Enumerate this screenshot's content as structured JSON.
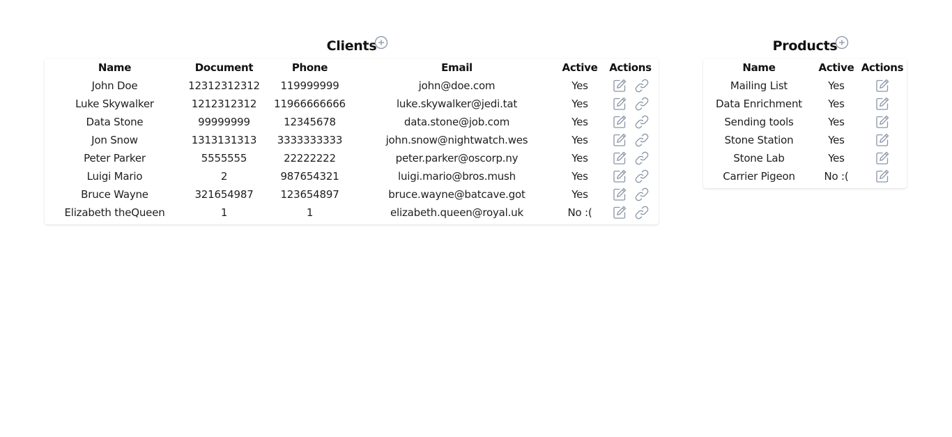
{
  "clients": {
    "title": "Clients",
    "columns": [
      "Name",
      "Document",
      "Phone",
      "Email",
      "Active",
      "Actions"
    ],
    "rows": [
      {
        "name": "John Doe",
        "document": "12312312312",
        "phone": "119999999",
        "email": "john@doe.com",
        "active": "Yes"
      },
      {
        "name": "Luke Skywalker",
        "document": "1212312312",
        "phone": "11966666666",
        "email": "luke.skywalker@jedi.tat",
        "active": "Yes"
      },
      {
        "name": "Data Stone",
        "document": "99999999",
        "phone": "12345678",
        "email": "data.stone@job.com",
        "active": "Yes"
      },
      {
        "name": "Jon Snow",
        "document": "1313131313",
        "phone": "3333333333",
        "email": "john.snow@nightwatch.wes",
        "active": "Yes"
      },
      {
        "name": "Peter Parker",
        "document": "5555555",
        "phone": "22222222",
        "email": "peter.parker@oscorp.ny",
        "active": "Yes"
      },
      {
        "name": "Luigi Mario",
        "document": "2",
        "phone": "987654321",
        "email": "luigi.mario@bros.mush",
        "active": "Yes"
      },
      {
        "name": "Bruce Wayne",
        "document": "321654987",
        "phone": "123654897",
        "email": "bruce.wayne@batcave.got",
        "active": "Yes"
      },
      {
        "name": "Elizabeth theQueen",
        "document": "1",
        "phone": "1",
        "email": "elizabeth.queen@royal.uk",
        "active": "No :("
      }
    ],
    "row_actions": [
      "edit-icon",
      "link-icon"
    ]
  },
  "products": {
    "title": "Products",
    "columns": [
      "Name",
      "Active",
      "Actions"
    ],
    "rows": [
      {
        "name": "Mailing List",
        "active": "Yes"
      },
      {
        "name": "Data Enrichment",
        "active": "Yes"
      },
      {
        "name": "Sending tools",
        "active": "Yes"
      },
      {
        "name": "Stone Station",
        "active": "Yes"
      },
      {
        "name": "Stone Lab",
        "active": "Yes"
      },
      {
        "name": "Carrier Pigeon",
        "active": "No :("
      }
    ],
    "row_actions": [
      "edit-icon"
    ]
  },
  "colors": {
    "icon": "#8a93a6",
    "text": "#1e1e1e",
    "heading": "#111111"
  }
}
